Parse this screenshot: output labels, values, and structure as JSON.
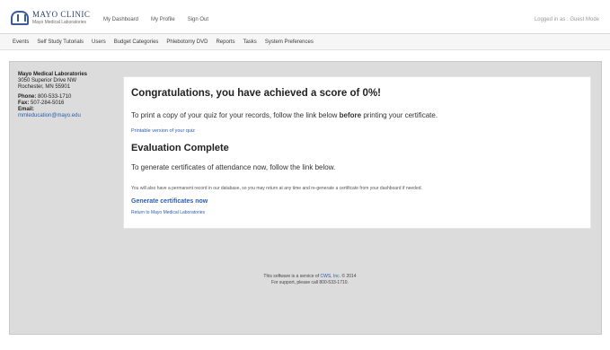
{
  "header": {
    "logo_line1": "MAYO CLINIC",
    "logo_line2": "Mayo Medical Laboratories",
    "nav": [
      "My Dashboard",
      "My Profile",
      "Sign Out"
    ],
    "user": "Logged in as : Guest Mode"
  },
  "menu": {
    "items": [
      "Events",
      "Self Study Tutorials",
      "Users",
      "Budget Categories",
      "Phlebotomy DVD",
      "Reports",
      "Tasks",
      "System Preferences"
    ]
  },
  "sidebar": {
    "org": "Mayo Medical Laboratories",
    "address1": "3050 Superior Drive NW",
    "address2": "Rochester, MN 55901",
    "phone_label": "Phone:",
    "phone": "800-533-1710",
    "fax_label": "Fax:",
    "fax": "507-284-5016",
    "email_label": "Email:",
    "email": "mmleducation@mayo.edu"
  },
  "main": {
    "score_title": "Congratulations, you have achieved a score of 0%!",
    "print_pre": "To print a copy of your quiz for your records, follow the link below ",
    "print_bold": "before",
    "print_post": " printing your certificate.",
    "print_link": "Printable version of your quiz",
    "eval_title": "Evaluation Complete",
    "cert_text": "To generate certificates of attendance now, follow the link below.",
    "note": "You will also have a permanent record in our database, so you may return at any time and re-generate a certificate from your dashboard if needed.",
    "generate_link": "Generate certificates now",
    "return_link": "Return to Mayo Medical Laboratories"
  },
  "footer": {
    "line1_pre": "This software is a service of ",
    "line1_link": "CWS, Inc.",
    "line1_post": " © 2014",
    "line2": "For support, please call 800-533-1710."
  }
}
